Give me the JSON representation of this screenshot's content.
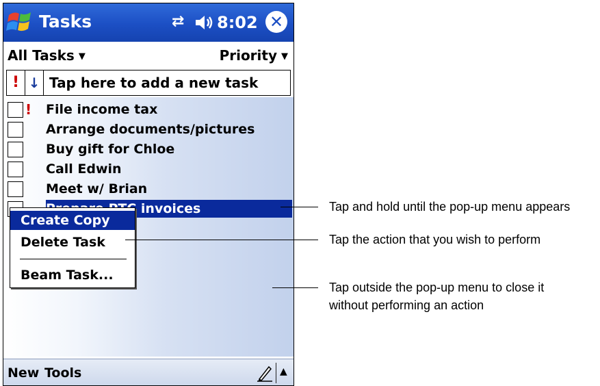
{
  "titlebar": {
    "app_title": "Tasks",
    "connectivity_icon": "connectivity-arrows-icon",
    "volume_icon": "speaker-volume-icon",
    "clock": "8:02",
    "close_icon": "close-circle-icon"
  },
  "filterbar": {
    "category": "All Tasks",
    "sort": "Priority"
  },
  "entrybar": {
    "priority_symbol": "!",
    "sort_symbol": "↓",
    "placeholder": "Tap here to add a new task"
  },
  "tasks": [
    {
      "label": "File income tax",
      "high_priority": true,
      "checked": false
    },
    {
      "label": "Arrange documents/pictures",
      "high_priority": false,
      "checked": false
    },
    {
      "label": "Buy gift for Chloe",
      "high_priority": false,
      "checked": false
    },
    {
      "label": "Call Edwin",
      "high_priority": false,
      "checked": false
    },
    {
      "label": "Meet w/ Brian",
      "high_priority": false,
      "checked": false
    },
    {
      "label": "Prepare PTC invoices",
      "high_priority": false,
      "checked": false,
      "selected": true
    }
  ],
  "popup_menu": {
    "items": [
      "Create Copy",
      "Delete Task",
      "Beam Task..."
    ]
  },
  "menubar": {
    "new_label": "New",
    "tools_label": "Tools",
    "pen_icon": "pen-input-icon",
    "sip_icon": "sip-up-arrow-icon"
  },
  "callouts": [
    "Tap and hold until the pop-up menu appears",
    "Tap the action that you wish to perform",
    "Tap outside the pop-up menu to close it",
    "without performing an action"
  ],
  "colors": {
    "title_blue": "#1c4fc4",
    "selection": "#0a2a9c",
    "priority_red": "#cc0000"
  }
}
